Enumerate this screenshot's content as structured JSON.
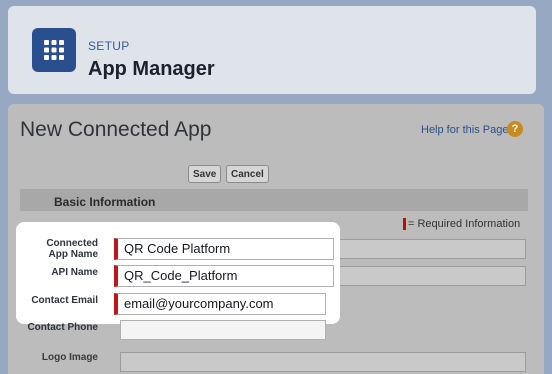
{
  "header": {
    "eyebrow": "SETUP",
    "title": "App Manager",
    "icon": "app-launcher-grid-icon"
  },
  "page": {
    "title": "New Connected App",
    "help_link": "Help for this Page",
    "help_icon": "?"
  },
  "buttons": {
    "save": "Save",
    "cancel": "Cancel"
  },
  "section": {
    "title": "Basic Information",
    "required_legend": "= Required Information"
  },
  "fields": {
    "connected_app_name": {
      "label_line1": "Connected",
      "label_line2": "App Name",
      "value": "QR Code Platform",
      "required": true
    },
    "api_name": {
      "label": "API Name",
      "value": "QR_Code_Platform",
      "required": true
    },
    "contact_email": {
      "label": "Contact Email",
      "value": "email@yourcompany.com",
      "required": true
    },
    "contact_phone": {
      "label": "Contact Phone",
      "value": ""
    },
    "logo_image": {
      "label": "Logo Image"
    }
  },
  "colors": {
    "required": "#c0141b",
    "brand": "#2a4f8e",
    "help_icon": "#c98a1e"
  }
}
